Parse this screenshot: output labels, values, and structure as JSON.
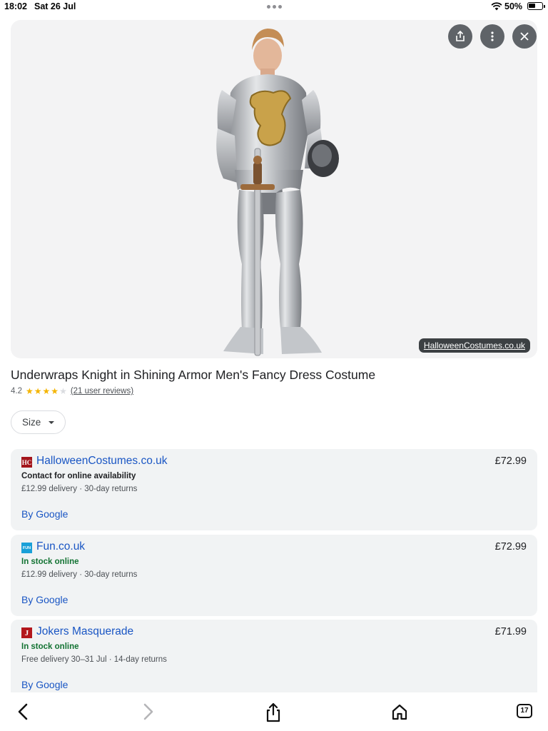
{
  "status_bar": {
    "time": "18:02",
    "date": "Sat 26 Jul",
    "battery": "50%"
  },
  "hero": {
    "image_alt": "Man wearing silver knight armour costume with gold lion crest, holding a sword and helmet",
    "source_label": "HalloweenCostumes.co.uk",
    "buttons": [
      "share-icon",
      "more-vert-icon",
      "close-icon"
    ]
  },
  "product": {
    "title": "Underwraps Knight in Shining Armor Men's Fancy Dress Costume",
    "rating": "4.2",
    "stars_filled": 4,
    "stars_total": 5,
    "reviews": "(21 user reviews)"
  },
  "size_filter": {
    "label": "Size"
  },
  "offers": [
    {
      "logo_text": "HC",
      "logo_color": "#a3151b",
      "seller": "HalloweenCostumes.co.uk",
      "price": "£72.99",
      "availability": "Contact for online availability",
      "availability_color": "#202124",
      "delivery": "£12.99 delivery · 30-day returns",
      "by": "By Google"
    },
    {
      "logo_text": "FUN",
      "logo_color": "#1aa0d8",
      "seller": "Fun.co.uk",
      "price": "£72.99",
      "availability": "In stock online",
      "availability_color": "#137333",
      "delivery": "£12.99 delivery · 30-day returns",
      "by": "By Google"
    },
    {
      "logo_text": "J",
      "logo_color": "#b3171c",
      "seller": "Jokers Masquerade",
      "price": "£71.99",
      "availability": "In stock online",
      "availability_color": "#137333",
      "delivery": "Free delivery 30–31 Jul · 14-day returns",
      "by": "By Google"
    }
  ],
  "toolbar": {
    "items": [
      "back-icon",
      "forward-icon",
      "share-icon",
      "home-icon",
      "tabs-icon"
    ],
    "tab_count": "17"
  }
}
